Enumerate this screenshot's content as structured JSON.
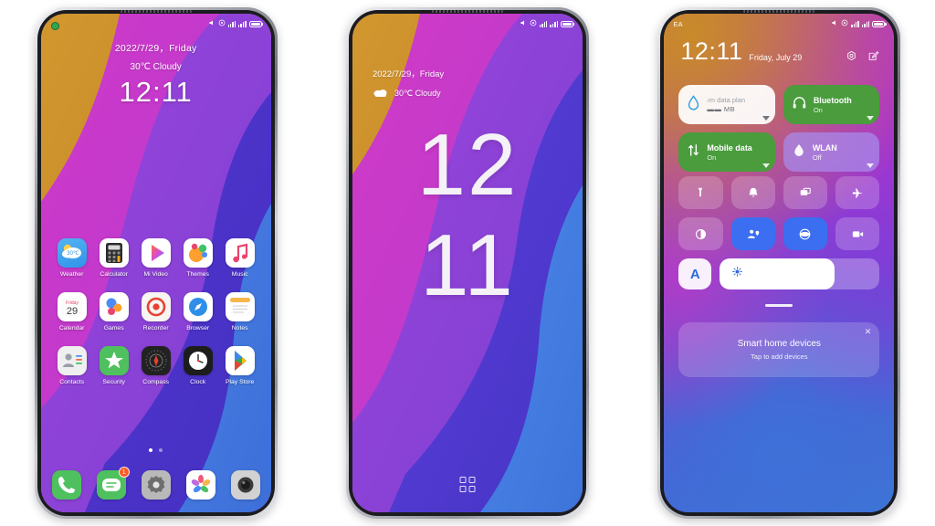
{
  "phone1": {
    "name": "home-screen",
    "status": {
      "carrier": "",
      "icons": [
        "mute-icon",
        "dnd-icon",
        "signal-bars",
        "battery-icon"
      ]
    },
    "lock": {
      "date": "2022/7/29，Friday",
      "weather": "30℃ Cloudy",
      "clock": "12:11"
    },
    "apps": [
      {
        "label": "Weather",
        "icon": "weather-icon",
        "temp": "30℃"
      },
      {
        "label": "Calculator",
        "icon": "calculator-icon"
      },
      {
        "label": "Mi Video",
        "icon": "mi-video-icon"
      },
      {
        "label": "Themes",
        "icon": "themes-icon"
      },
      {
        "label": "Music",
        "icon": "music-icon"
      },
      {
        "label": "Calendar",
        "icon": "calendar-icon",
        "day": "29",
        "weekday": "Friday"
      },
      {
        "label": "Games",
        "icon": "games-icon"
      },
      {
        "label": "Recorder",
        "icon": "recorder-icon"
      },
      {
        "label": "Browser",
        "icon": "browser-icon"
      },
      {
        "label": "Notes",
        "icon": "notes-icon"
      },
      {
        "label": "Contacts",
        "icon": "contacts-icon"
      },
      {
        "label": "Security",
        "icon": "security-icon"
      },
      {
        "label": "Compass",
        "icon": "compass-icon"
      },
      {
        "label": "Clock",
        "icon": "clock-icon"
      },
      {
        "label": "Play Store",
        "icon": "play-store-icon"
      }
    ],
    "page_indicator": {
      "pages": 2,
      "active": 1
    },
    "dock": [
      {
        "label": "Phone",
        "icon": "phone-icon"
      },
      {
        "label": "Messages",
        "icon": "messages-icon",
        "badge": "1"
      },
      {
        "label": "Settings",
        "icon": "settings-gear-icon"
      },
      {
        "label": "Gallery",
        "icon": "gallery-icon"
      },
      {
        "label": "Camera",
        "icon": "camera-icon"
      }
    ]
  },
  "phone2": {
    "name": "lock-screen",
    "date": "2022/7/29，Friday",
    "weather": "30℃ Cloudy",
    "weather_icon": "cloud-icon",
    "clock_hours": "12",
    "clock_minutes": "11",
    "drawer_icon": "app-grid-icon"
  },
  "phone3": {
    "name": "control-center",
    "status": {
      "carrier": "EA"
    },
    "time": "12:11",
    "day": "Friday, July 29",
    "actions": [
      {
        "name": "settings-gear-icon"
      },
      {
        "name": "edit-icon"
      }
    ],
    "big_tiles": [
      {
        "title": "‹m data plan",
        "sub": "▬▬ MB",
        "state": "light",
        "icon": "data-drop-icon"
      },
      {
        "title": "Bluetooth",
        "sub": "On",
        "state": "green",
        "icon": "bluetooth-headset-icon"
      },
      {
        "title": "Mobile data",
        "sub": "On",
        "state": "green",
        "icon": "mobile-data-icon"
      },
      {
        "title": "WLAN",
        "sub": "Off",
        "state": "violet",
        "icon": "wlan-icon"
      }
    ],
    "small_tiles": [
      {
        "name": "flashlight-icon",
        "active": false
      },
      {
        "name": "silent-bell-icon",
        "active": false
      },
      {
        "name": "screenshot-icon",
        "active": false
      },
      {
        "name": "airplane-icon",
        "active": false
      },
      {
        "name": "dark-mode-icon",
        "active": false
      },
      {
        "name": "location-icon",
        "active": true
      },
      {
        "name": "vpn-icon",
        "active": true
      },
      {
        "name": "screen-record-icon",
        "active": false
      }
    ],
    "brightness": {
      "auto_label": "A",
      "icon": "sun-icon",
      "percent": 72
    },
    "smart_card": {
      "title": "Smart home devices",
      "subtitle": "Tap to add devices",
      "close_icon": "close-icon",
      "close_label": "✕"
    }
  },
  "colors": {
    "wallpaper_orange": "#c98a2a",
    "wallpaper_magenta": "#c03ac8",
    "wallpaper_purple": "#8a43d4",
    "wallpaper_indigo": "#4b35c8",
    "wallpaper_blue": "#3f74df",
    "tile_green": "#4a9c3d",
    "tile_active_blue": "#3b6ef0",
    "badge_orange": "#ff5722"
  }
}
